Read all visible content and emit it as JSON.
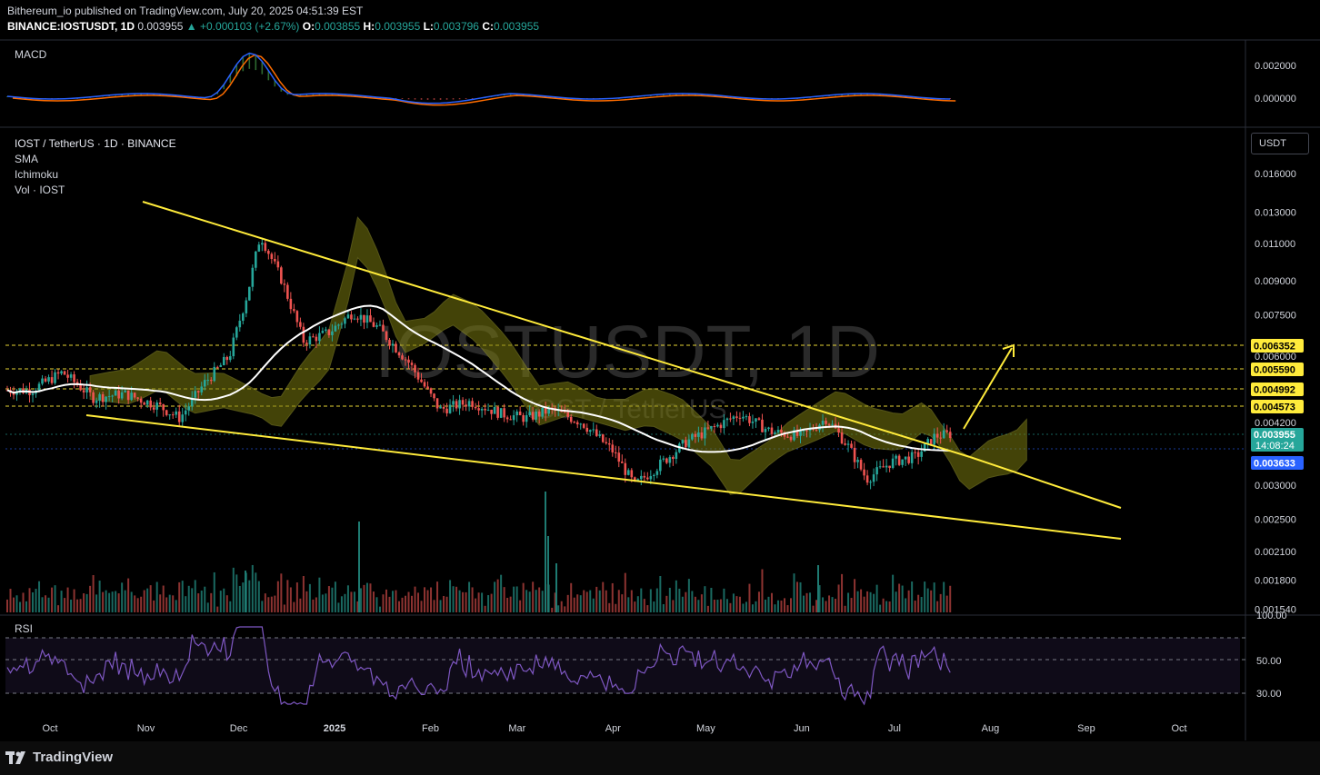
{
  "header": {
    "line1": "Bithereum_io published on TradingView.com, July 20, 2025 04:51:39 EST",
    "symbol": "BINANCE:IOSTUSDT, 1D",
    "last": "0.003955",
    "change": "+0.000103 (+2.67%)",
    "o_label": "O:",
    "o": "0.003855",
    "h_label": "H:",
    "h": "0.003955",
    "l_label": "L:",
    "l": "0.003796",
    "c_label": "C:",
    "c": "0.003955"
  },
  "macd_label": "MACD",
  "rsi_label": "RSI",
  "legend": {
    "title": "IOST / TetherUS · 1D · BINANCE",
    "items": [
      "SMA",
      "Ichimoku",
      "Vol · IOST"
    ]
  },
  "watermark": {
    "main": "IOSTUSDT, 1D",
    "sub": "IOST / TetherUS"
  },
  "currency_button": "USDT",
  "footer_logo": "TradingView",
  "colors": {
    "up": "#26a69a",
    "down": "#ef5350",
    "trend": "#ffeb3b",
    "sma": "#ffffff",
    "cloud": "#808000",
    "rsi": "#7e57c2",
    "macd": "#2962ff",
    "signal": "#ff6d00",
    "level": "#ffeb3b",
    "current": "#26a69a",
    "blue_tag": "#2962ff"
  },
  "chart_data": {
    "type": "line",
    "title": "IOST / TetherUS · 1D · BINANCE",
    "x_ticks": [
      "Oct",
      "Nov",
      "Dec",
      "2025",
      "Feb",
      "Mar",
      "Apr",
      "May",
      "Jun",
      "Jul",
      "Aug",
      "Sep",
      "Oct"
    ],
    "y_ticks": [
      "0.016000",
      "0.013000",
      "0.011000",
      "0.009000",
      "0.007500",
      "0.006000",
      "0.004200",
      "0.003000",
      "0.002500",
      "0.002100",
      "0.001800",
      "0.001540"
    ],
    "y_scale": "log",
    "series": [
      {
        "x": [
          "2024-09-25",
          "2024-10-05",
          "2024-10-15",
          "2024-10-25",
          "2024-11-05",
          "2024-11-12",
          "2024-11-20",
          "2024-11-28",
          "2024-12-04",
          "2024-12-08",
          "2024-12-15",
          "2024-12-22",
          "2024-12-30",
          "2025-01-07",
          "2025-01-15",
          "2025-01-25",
          "2025-02-04",
          "2025-02-14",
          "2025-02-24",
          "2025-03-04",
          "2025-03-12",
          "2025-03-22",
          "2025-04-01",
          "2025-04-08",
          "2025-04-15",
          "2025-04-25",
          "2025-05-04",
          "2025-05-12",
          "2025-05-22",
          "2025-06-01",
          "2025-06-09",
          "2025-06-16",
          "2025-06-22",
          "2025-06-30",
          "2025-07-08",
          "2025-07-14",
          "2025-07-19"
        ],
        "values": [
          0.005,
          0.0055,
          0.0048,
          0.0049,
          0.0046,
          0.0043,
          0.0052,
          0.006,
          0.0085,
          0.0115,
          0.009,
          0.0065,
          0.0068,
          0.0076,
          0.007,
          0.0058,
          0.0045,
          0.0047,
          0.0044,
          0.0043,
          0.0045,
          0.0042,
          0.0036,
          0.003,
          0.0033,
          0.0038,
          0.0041,
          0.0044,
          0.004,
          0.0039,
          0.0043,
          0.0037,
          0.0031,
          0.0034,
          0.0035,
          0.0039,
          0.00395
        ]
      }
    ],
    "levels": [
      "0.006352",
      "0.005590",
      "0.004992",
      "0.004573",
      "0.003955",
      "0.003633"
    ],
    "countdown": "14:08:24",
    "macd_ticks": [
      "0.002000",
      "0.000000"
    ],
    "rsi_ticks": [
      "100.00",
      "50.00",
      "30.00"
    ]
  }
}
